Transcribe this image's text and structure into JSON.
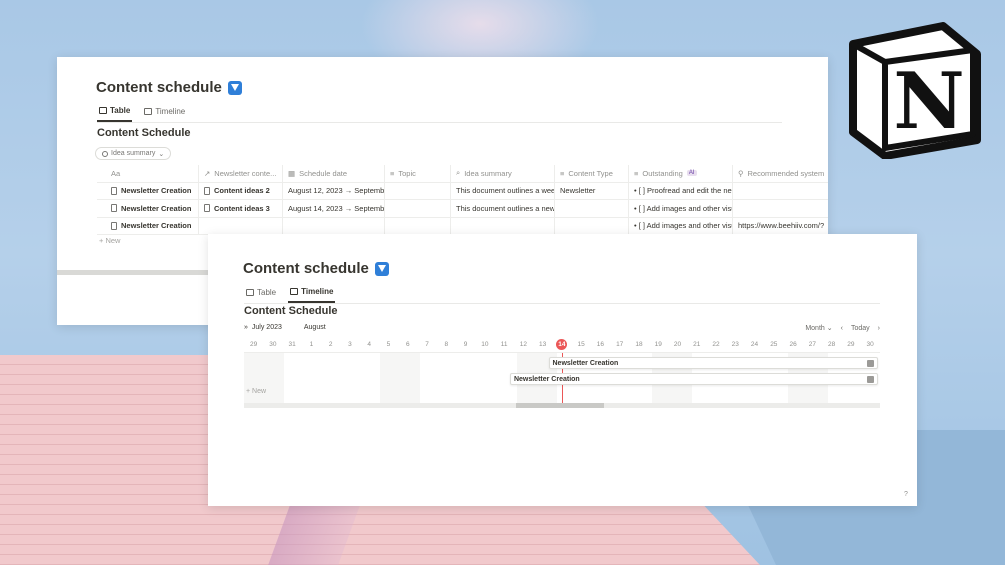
{
  "colors": {
    "accent": "#2f7fd8",
    "today": "#eb5757",
    "text": "#37352f"
  },
  "logo": {
    "letter": "N",
    "icon": "notion-logo-icon"
  },
  "table_window": {
    "title": "Content schedule",
    "tabs": [
      {
        "label": "Table",
        "active": true
      },
      {
        "label": "Timeline",
        "active": false
      }
    ],
    "db_title": "Content Schedule",
    "filter": "Idea summary",
    "columns": [
      "Aa",
      "Newsletter conte...",
      "Schedule date",
      "Topic",
      "Idea summary",
      "Content Type",
      "Outstanding",
      "Recommended system"
    ],
    "ai_badge": "AI",
    "rows": [
      [
        "Newsletter Creation",
        "Content ideas 2",
        "August 12, 2023 → September",
        "",
        "This document outlines a week",
        "Newsletter",
        "• [ ] Proofread and edit the nev",
        ""
      ],
      [
        "Newsletter Creation",
        "Content ideas 3",
        "August 14, 2023 → September",
        "",
        "This document outlines a news",
        "",
        "• [ ] Add images and other visu",
        ""
      ],
      [
        "Newsletter Creation",
        "",
        "",
        "",
        "",
        "",
        "• [ ] Add images and other visu",
        "https://www.beehiiv.com/?"
      ]
    ],
    "new_label": "+ New"
  },
  "timeline_window": {
    "title": "Content schedule",
    "tabs": [
      {
        "label": "Table",
        "active": false
      },
      {
        "label": "Timeline",
        "active": true
      }
    ],
    "db_title": "Content Schedule",
    "month_current": "July 2023",
    "month_next": "August",
    "view_select": "Month",
    "today_label": "Today",
    "days": [
      "29",
      "30",
      "31",
      "1",
      "2",
      "3",
      "4",
      "5",
      "6",
      "7",
      "8",
      "9",
      "10",
      "11",
      "12",
      "13",
      "14",
      "15",
      "16",
      "17",
      "18",
      "19",
      "20",
      "21",
      "22",
      "23",
      "24",
      "25",
      "26",
      "27",
      "28",
      "29",
      "30"
    ],
    "today_index": 16,
    "bars": [
      {
        "label": "Newsletter Creation",
        "start_index": 16
      },
      {
        "label": "Newsletter Creation",
        "start_index": 14
      }
    ],
    "new_label": "+ New",
    "help": "?"
  }
}
